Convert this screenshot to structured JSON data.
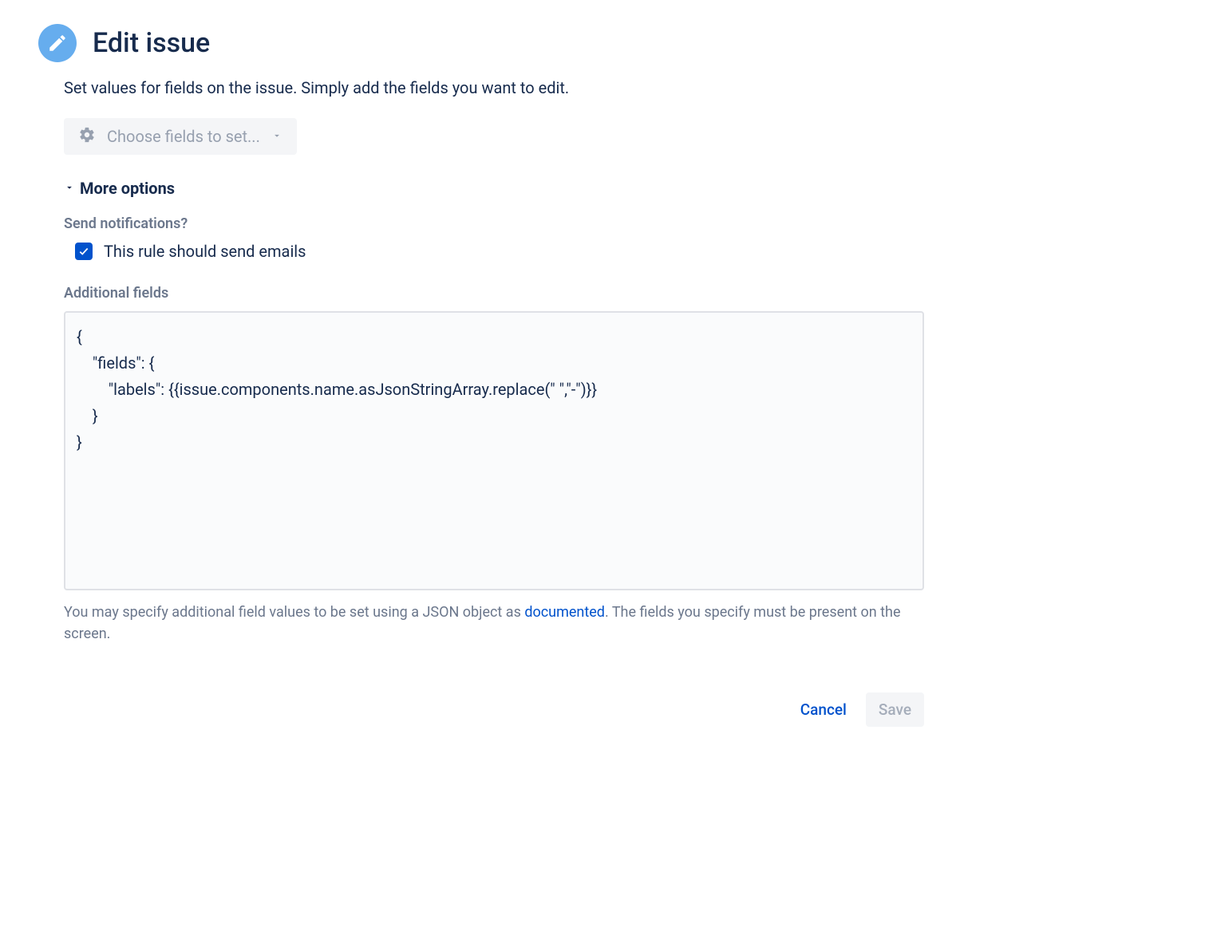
{
  "header": {
    "title": "Edit issue"
  },
  "description": "Set values for fields on the issue. Simply add the fields you want to edit.",
  "fieldChooser": {
    "placeholder": "Choose fields to set..."
  },
  "moreOptions": {
    "label": "More options"
  },
  "notifications": {
    "sectionLabel": "Send notifications?",
    "checkboxLabel": "This rule should send emails",
    "checked": true
  },
  "additionalFields": {
    "sectionLabel": "Additional fields",
    "value": "{\n    \"fields\": {\n        \"labels\": {{issue.components.name.asJsonStringArray.replace(\" \",\"-\")}}\n    }\n}"
  },
  "helperText": {
    "prefix": "You may specify additional field values to be set using a JSON object as ",
    "link": "documented",
    "suffix": ". The fields you specify must be present on the screen."
  },
  "buttons": {
    "cancel": "Cancel",
    "save": "Save"
  }
}
